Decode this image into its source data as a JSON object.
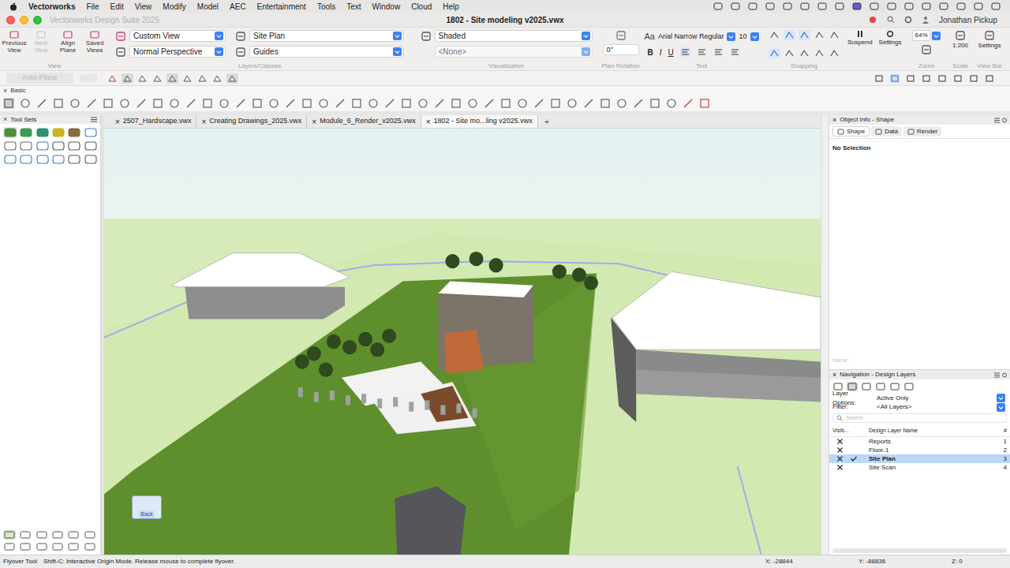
{
  "menu_bar": {
    "app": "Vectorworks",
    "items": [
      "File",
      "Edit",
      "View",
      "Modify",
      "Model",
      "AEC",
      "Entertainment",
      "Tools",
      "Text",
      "Window",
      "Cloud",
      "Help"
    ]
  },
  "title_bar": {
    "app_title": "Vectorworks Design Suite 2025",
    "document": "1802 - Site modeling v2025.vwx",
    "user": "Jonathan Pickup"
  },
  "view_bar": {
    "view_buttons": [
      {
        "label": "Previous View",
        "disabled": false
      },
      {
        "label": "Next View",
        "disabled": true
      },
      {
        "label": "Align Plane",
        "disabled": false
      },
      {
        "label": "Saved Views",
        "disabled": false
      }
    ],
    "view_label": "View",
    "standard_view": "Custom View",
    "projection": "Normal Perspective",
    "active_layer": "Site Plan",
    "active_class": "Guides",
    "layers_label": "Layers/Classes",
    "render_mode": "Shaded",
    "light_option": "<None>",
    "visualization_label": "Visualization",
    "plan_rotation": "0°",
    "plan_rotation_label": "Plan Rotation",
    "font": "Arial Narrow Regular",
    "font_size": "10",
    "text_styles": [
      "B",
      "I",
      "U"
    ],
    "text_label": "Text",
    "snapping_label": "Snapping",
    "suspend": "Suspend",
    "snap_settings": "Settings",
    "zoom": "64%",
    "zoom_label": "Zoom",
    "scale": "1:200",
    "scale_label": "Scale",
    "view_bar_settings": "Settings",
    "view_bar_label": "View Bar"
  },
  "mode_bar": {
    "auto_plane": {
      "label": "Auto-Plane",
      "disabled": true
    }
  },
  "basic_palette": {
    "title": "Basic"
  },
  "tool_sets": {
    "title": "Tool Sets"
  },
  "document_tabs": {
    "close_glyph": "×",
    "new_tab": "+",
    "items": [
      {
        "label": "2507_Hardscape.vwx",
        "selected": false
      },
      {
        "label": "Creating Drawings_2025.vwx",
        "selected": false
      },
      {
        "label": "Module_6_Render_v2025.vwx",
        "selected": false
      },
      {
        "label": "1802 - Site mo...ling v2025.vwx",
        "selected": true
      }
    ]
  },
  "viewport": {
    "view_cube_label": "Back"
  },
  "object_info": {
    "title": "Object Info - Shape",
    "tabs": [
      {
        "label": "Shape",
        "selected": true
      },
      {
        "label": "Data",
        "selected": false
      },
      {
        "label": "Render",
        "selected": false
      }
    ],
    "message": "No Selection",
    "name_label": "Name:"
  },
  "navigation": {
    "title": "Navigation - Design Layers",
    "layer_options_label": "Layer Options:",
    "layer_options": "Active Only",
    "filter_label": "Filter:",
    "filter": "<All Layers>",
    "search_placeholder": "Search",
    "columns": [
      "Visib...",
      "Design Layer Name",
      "#"
    ],
    "rows": [
      {
        "name": "Reports",
        "number": "1",
        "visible": true,
        "active": false,
        "selected": false
      },
      {
        "name": "Floor-1",
        "number": "2",
        "visible": true,
        "active": false,
        "selected": false
      },
      {
        "name": "Site Plan",
        "number": "3",
        "visible": true,
        "active": true,
        "selected": true
      },
      {
        "name": "Site Scan",
        "number": "4",
        "visible": true,
        "active": false,
        "selected": false
      }
    ]
  },
  "status_bar": {
    "tool": "Flyover Tool",
    "hint": "Shift-C: Interactive Origin Mode. Release mouse to complete flyover.",
    "x": "X: -28844",
    "y": "Y: -88836",
    "z": "Z: 0"
  }
}
